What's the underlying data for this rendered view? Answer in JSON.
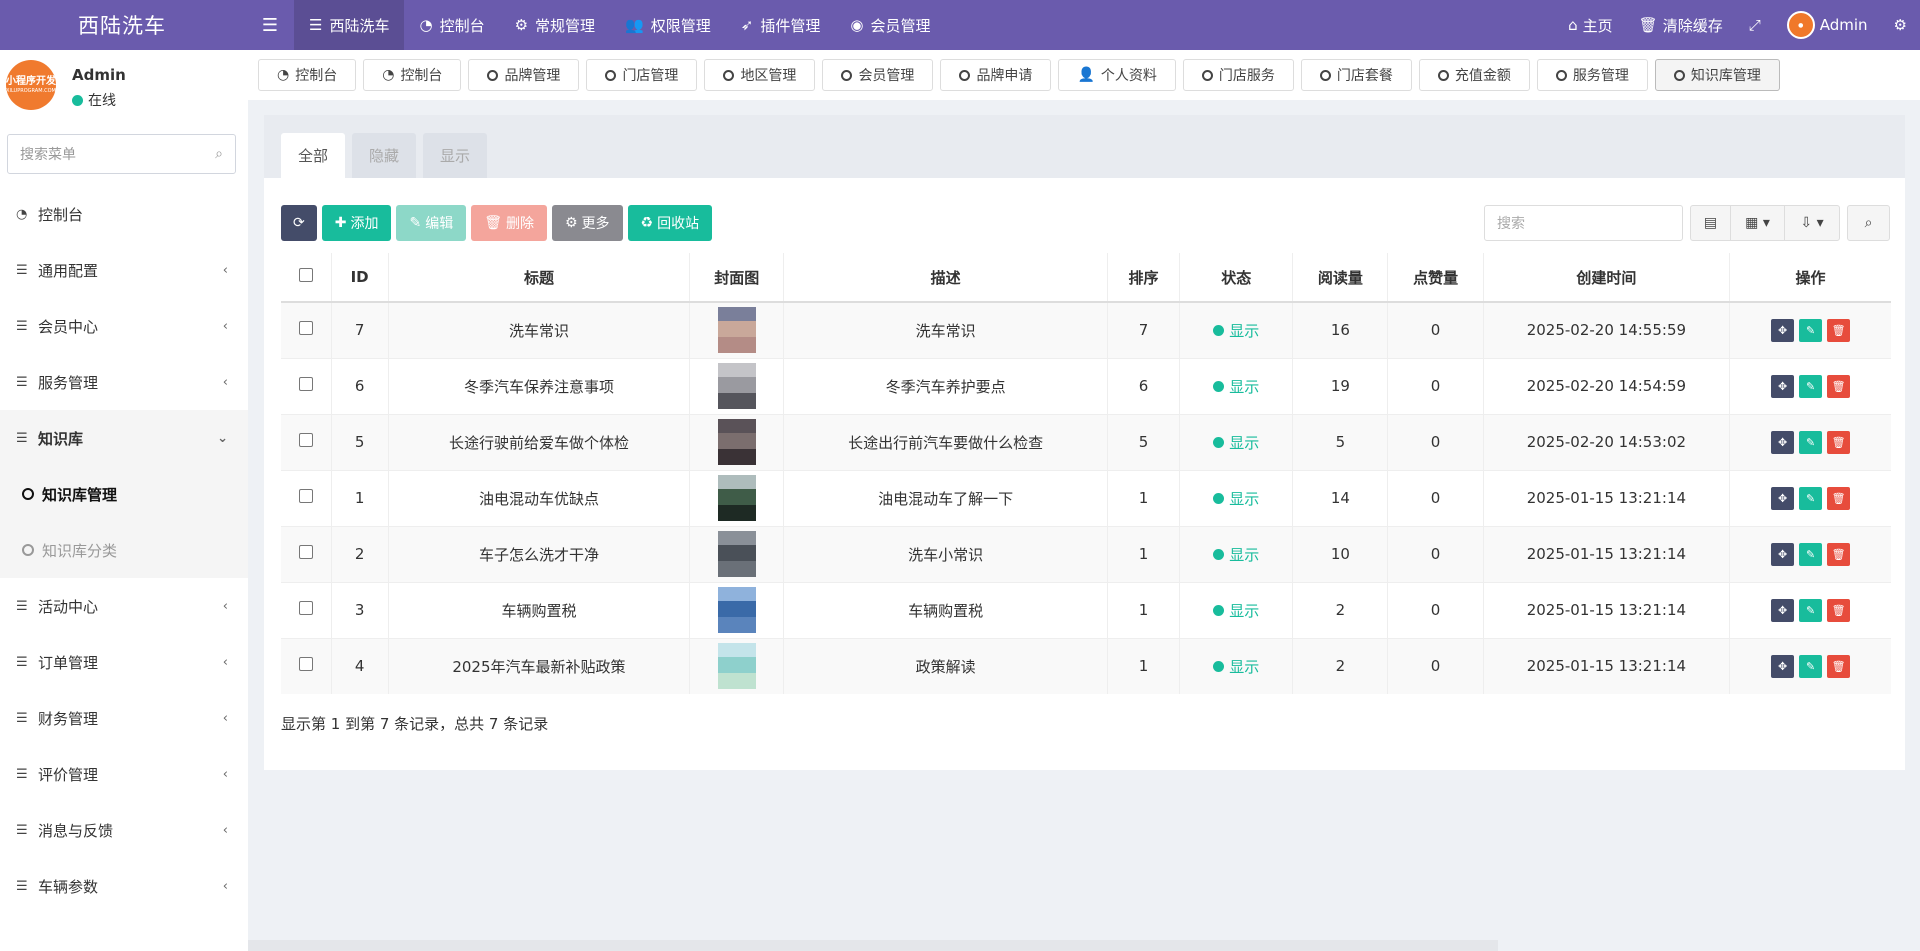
{
  "header": {
    "brand": "西陆洗车",
    "nav": [
      {
        "label": "西陆洗车",
        "icon": "list-icon",
        "active": true
      },
      {
        "label": "控制台",
        "icon": "dashboard-icon",
        "active": false
      },
      {
        "label": "常规管理",
        "icon": "cogs-icon",
        "active": false
      },
      {
        "label": "权限管理",
        "icon": "users-icon",
        "active": false
      },
      {
        "label": "插件管理",
        "icon": "rocket-icon",
        "active": false
      },
      {
        "label": "会员管理",
        "icon": "user-circle-icon",
        "active": false
      }
    ],
    "right": {
      "home_label": "主页",
      "clear_cache_label": "清除缓存",
      "admin_name": "Admin"
    }
  },
  "sidebar": {
    "user_name": "Admin",
    "user_status": "在线",
    "avatar_logo_line1": "小程序开发",
    "avatar_logo_line2": "XILUPROGRAM.COM",
    "search_placeholder": "搜索菜单",
    "items": [
      {
        "label": "控制台",
        "icon": "dashboard-icon",
        "has_caret": false
      },
      {
        "label": "通用配置",
        "icon": "list-icon",
        "has_caret": true
      },
      {
        "label": "会员中心",
        "icon": "list-icon",
        "has_caret": true
      },
      {
        "label": "服务管理",
        "icon": "list-icon",
        "has_caret": true
      },
      {
        "label": "知识库",
        "icon": "list-icon",
        "has_caret": true,
        "open": true
      },
      {
        "label": "活动中心",
        "icon": "list-icon",
        "has_caret": true
      },
      {
        "label": "订单管理",
        "icon": "list-icon",
        "has_caret": true
      },
      {
        "label": "财务管理",
        "icon": "list-icon",
        "has_caret": true
      },
      {
        "label": "评价管理",
        "icon": "list-icon",
        "has_caret": true
      },
      {
        "label": "消息与反馈",
        "icon": "list-icon",
        "has_caret": true
      },
      {
        "label": "车辆参数",
        "icon": "list-icon",
        "has_caret": true
      }
    ],
    "submenu": [
      {
        "label": "知识库管理",
        "active": true
      },
      {
        "label": "知识库分类",
        "active": false
      }
    ]
  },
  "tabs": [
    {
      "label": "控制台",
      "icon": "dashboard-icon",
      "active": false
    },
    {
      "label": "控制台",
      "icon": "dashboard-icon",
      "active": false
    },
    {
      "label": "品牌管理",
      "icon": "circle-icon",
      "active": false
    },
    {
      "label": "门店管理",
      "icon": "circle-icon",
      "active": false
    },
    {
      "label": "地区管理",
      "icon": "circle-icon",
      "active": false
    },
    {
      "label": "会员管理",
      "icon": "circle-icon",
      "active": false
    },
    {
      "label": "品牌申请",
      "icon": "circle-icon",
      "active": false
    },
    {
      "label": "个人资料",
      "icon": "user-icon",
      "active": false
    },
    {
      "label": "门店服务",
      "icon": "circle-icon",
      "active": false
    },
    {
      "label": "门店套餐",
      "icon": "circle-icon",
      "active": false
    },
    {
      "label": "充值金额",
      "icon": "circle-icon",
      "active": false
    },
    {
      "label": "服务管理",
      "icon": "circle-icon",
      "active": false
    },
    {
      "label": "知识库管理",
      "icon": "circle-icon",
      "active": true
    }
  ],
  "filter_tabs": [
    {
      "label": "全部",
      "active": true
    },
    {
      "label": "隐藏",
      "active": false
    },
    {
      "label": "显示",
      "active": false
    }
  ],
  "toolbar": {
    "add_label": "添加",
    "edit_label": "编辑",
    "delete_label": "删除",
    "more_label": "更多",
    "recycle_label": "回收站",
    "search_placeholder": "搜索"
  },
  "table": {
    "headers": [
      "ID",
      "标题",
      "封面图",
      "描述",
      "排序",
      "状态",
      "阅读量",
      "点赞量",
      "创建时间",
      "操作"
    ],
    "rows": [
      {
        "id": "7",
        "title": "洗车常识",
        "desc": "洗车常识",
        "sort": "7",
        "status": "显示",
        "reads": "16",
        "likes": "0",
        "created": "2025-02-20 14:55:59",
        "cover_colors": [
          "#7a7f9a",
          "#c9a89a",
          "#b48c86"
        ]
      },
      {
        "id": "6",
        "title": "冬季汽车保养注意事项",
        "desc": "冬季汽车养护要点",
        "sort": "6",
        "status": "显示",
        "reads": "19",
        "likes": "0",
        "created": "2025-02-20 14:54:59",
        "cover_colors": [
          "#c4c4c8",
          "#9a9aa0",
          "#55555c"
        ]
      },
      {
        "id": "5",
        "title": "长途行驶前给爱车做个体检",
        "desc": "长途出行前汽车要做什么检查",
        "sort": "5",
        "status": "显示",
        "reads": "5",
        "likes": "0",
        "created": "2025-02-20 14:53:02",
        "cover_colors": [
          "#5a5258",
          "#7b6e6e",
          "#3a3236"
        ]
      },
      {
        "id": "1",
        "title": "油电混动车优缺点",
        "desc": "油电混动车了解一下",
        "sort": "1",
        "status": "显示",
        "reads": "14",
        "likes": "0",
        "created": "2025-01-15 13:21:14",
        "cover_colors": [
          "#aebcbc",
          "#3f5c48",
          "#1e2a24"
        ]
      },
      {
        "id": "2",
        "title": "车子怎么洗才干净",
        "desc": "洗车小常识",
        "sort": "1",
        "status": "显示",
        "reads": "10",
        "likes": "0",
        "created": "2025-01-15 13:21:14",
        "cover_colors": [
          "#8a9098",
          "#4a5058",
          "#6a7078"
        ]
      },
      {
        "id": "3",
        "title": "车辆购置税",
        "desc": "车辆购置税",
        "sort": "1",
        "status": "显示",
        "reads": "2",
        "likes": "0",
        "created": "2025-01-15 13:21:14",
        "cover_colors": [
          "#8fb2dc",
          "#3a6aa8",
          "#5a84bc"
        ]
      },
      {
        "id": "4",
        "title": "2025年汽车最新补贴政策",
        "desc": "政策解读",
        "sort": "1",
        "status": "显示",
        "reads": "2",
        "likes": "0",
        "created": "2025-01-15 13:21:14",
        "cover_colors": [
          "#c4e4ea",
          "#8ed0cc",
          "#bfe2d0"
        ]
      }
    ]
  },
  "pagination_text": "显示第 1 到第 7 条记录，总共 7 条记录",
  "colors": {
    "topbar": "#6a5bad",
    "accent_green": "#18bc9c",
    "danger": "#e74c3c",
    "dark": "#444c69"
  }
}
